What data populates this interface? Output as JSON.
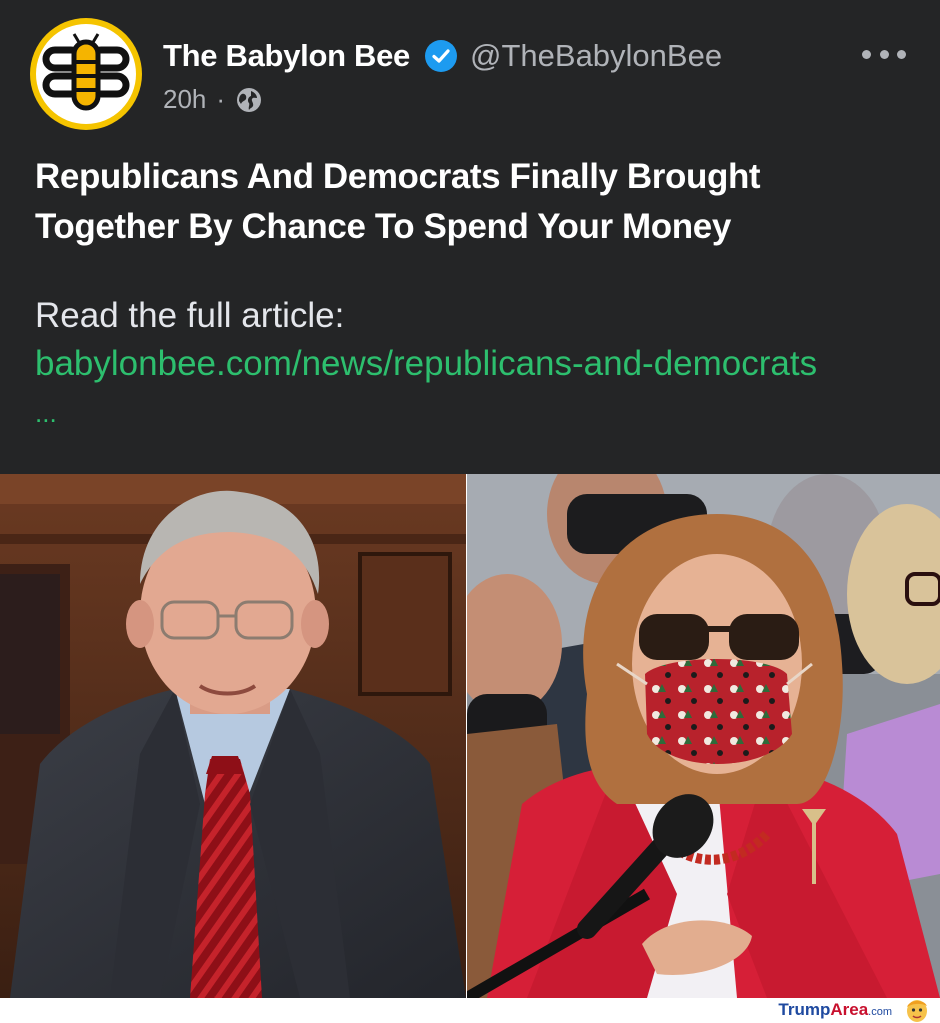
{
  "post": {
    "author": "The Babylon Bee",
    "handle": "@TheBabylonBee",
    "time": "20h",
    "separator": "·",
    "headline_line1": "Republicans And Democrats Finally Brought",
    "headline_line2": "Together By Chance To Spend Your Money",
    "read_label": "Read the full article:",
    "link": "babylonbee.com/news/republicans-and-democrats",
    "link_ellipsis": "...",
    "icons": [
      "bee-logo-icon",
      "verified-badge-icon",
      "globe-icon",
      "more-options-icon"
    ]
  },
  "colors": {
    "background": "#242526",
    "link": "#2dbf6e",
    "verified": "#1d9bf0",
    "logo_ring": "#f5c400"
  },
  "watermark": {
    "part1": "Trump",
    "part2": "Area",
    "part3": ".com"
  }
}
